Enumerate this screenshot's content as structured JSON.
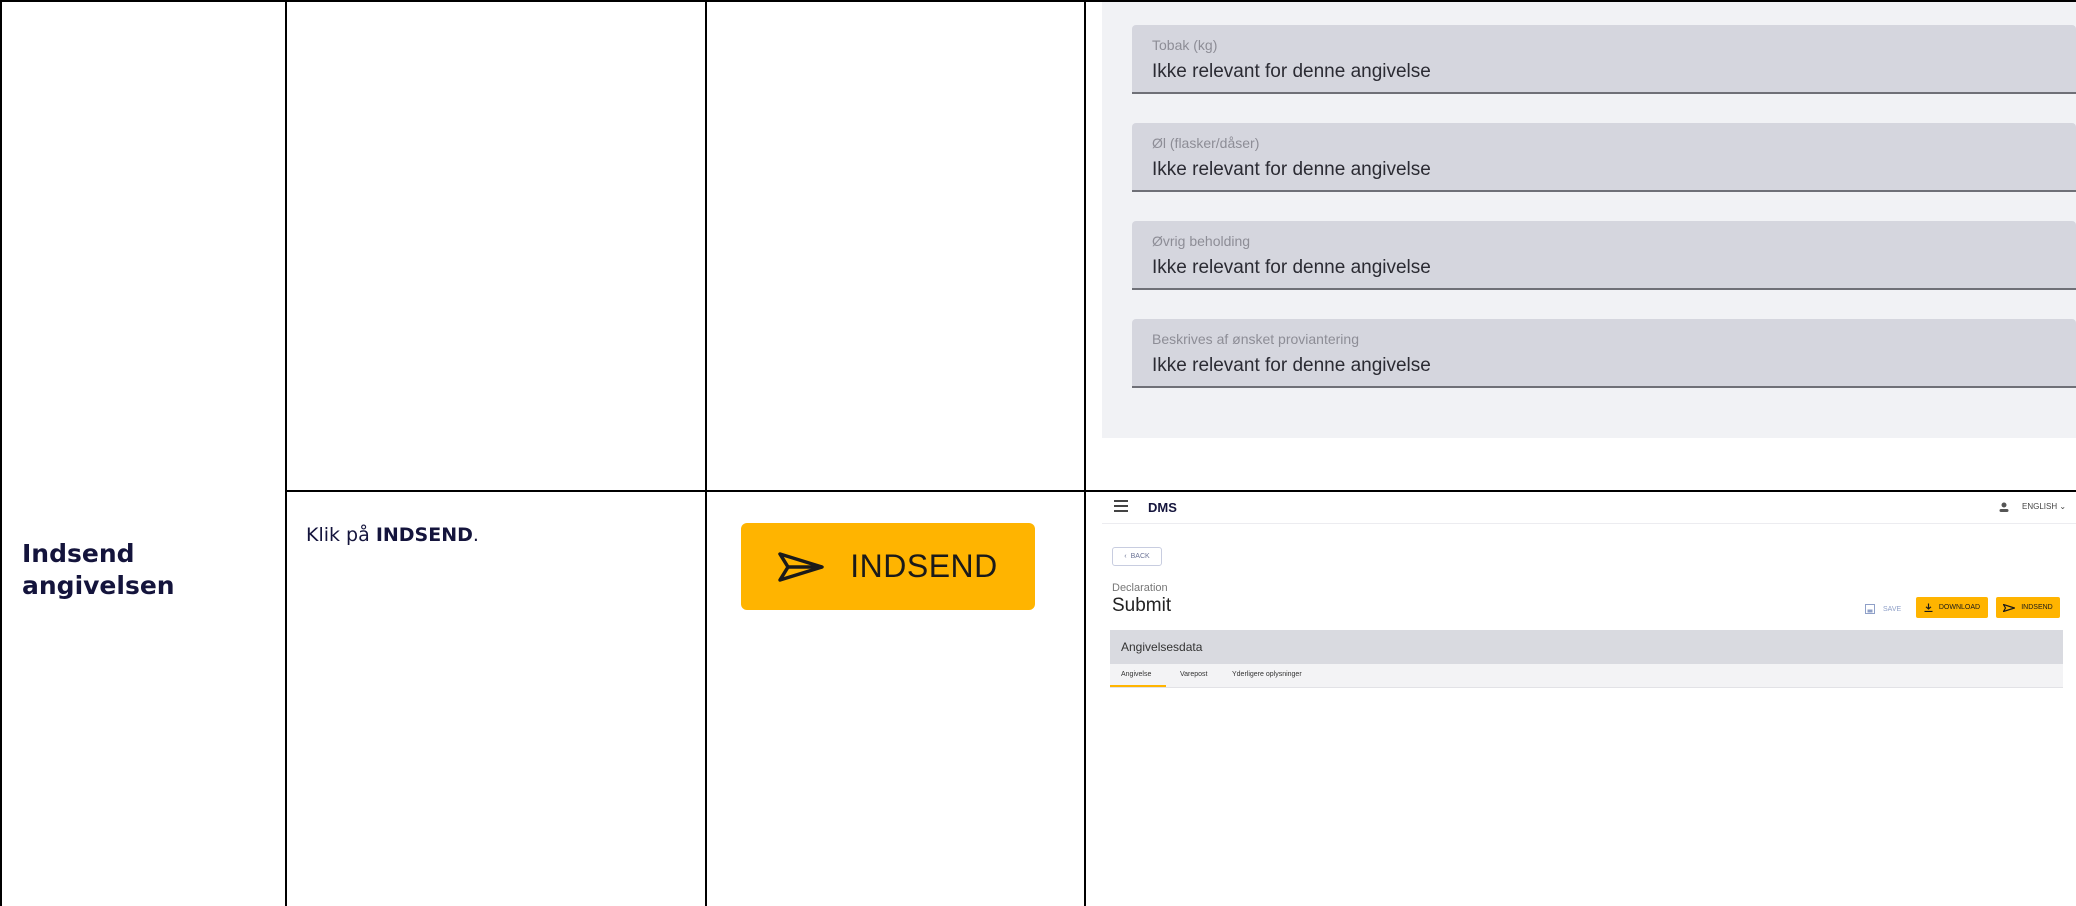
{
  "step": {
    "title_line1": "Indsend",
    "title_line2": "angivelsen",
    "instruction_prefix": "Klik på ",
    "instruction_bold": "INDSEND",
    "instruction_suffix": "."
  },
  "big_button": {
    "label": "INDSEND",
    "icon": "send-icon",
    "color": "#ffb400"
  },
  "fields_panel": {
    "fields": [
      {
        "label": "Tobak (kg)",
        "value": "Ikke relevant for denne angivelse"
      },
      {
        "label": "Øl (flasker/dåser)",
        "value": "Ikke relevant for denne angivelse"
      },
      {
        "label": "Øvrig beholding",
        "value": "Ikke relevant for denne angivelse"
      },
      {
        "label": "Beskrives af ønsket proviantering",
        "value": "Ikke relevant for denne angivelse"
      }
    ]
  },
  "app": {
    "brand": "DMS",
    "language": "ENGLISH",
    "back_label": "BACK",
    "breadcrumb": "Declaration",
    "page_title": "Submit",
    "save_label": "SAVE",
    "download_label": "DOWNLOAD",
    "submit_label": "INDSEND",
    "section_title": "Angivelsesdata",
    "tabs": [
      "Angivelse",
      "Varepost",
      "Yderligere oplysninger"
    ],
    "accent_color": "#ffb400"
  }
}
